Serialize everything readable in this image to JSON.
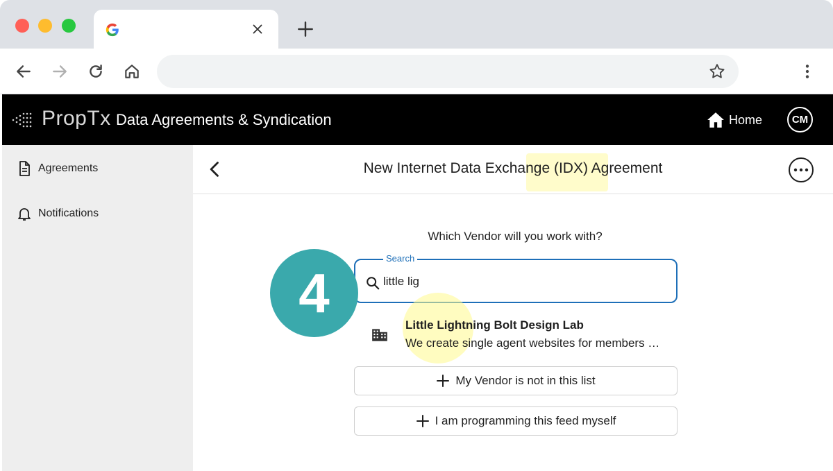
{
  "browser": {
    "icons": [
      "google-favicon",
      "close-icon",
      "plus-icon",
      "arrow-left-icon",
      "arrow-right-icon",
      "reload-icon",
      "home-icon",
      "star-icon",
      "kebab-icon"
    ]
  },
  "header": {
    "brand": "PropTx",
    "title": "Data Agreements & Syndication",
    "home_label": "Home",
    "avatar_initials": "CM"
  },
  "sidebar": {
    "items": [
      {
        "label": "Agreements",
        "icon": "document-icon"
      },
      {
        "label": "Notifications",
        "icon": "bell-icon"
      }
    ]
  },
  "main": {
    "title": "New Internet Data Exchange (IDX) Agreement",
    "question": "Which Vendor will you work with?",
    "search": {
      "label": "Search",
      "value": "little lig"
    },
    "result": {
      "title": "Little Lightning Bolt Design Lab",
      "description": "We create single agent websites for members …",
      "icon": "building-icon"
    },
    "options": {
      "vendor_not_listed": "My Vendor is not in this list",
      "program_myself": "I am programming this feed myself"
    }
  },
  "step_badge": "4",
  "colors": {
    "header_bg": "#000000",
    "accent": "#1e6fb8",
    "badge": "#3aa9ac",
    "highlight": "#fffaa0"
  }
}
